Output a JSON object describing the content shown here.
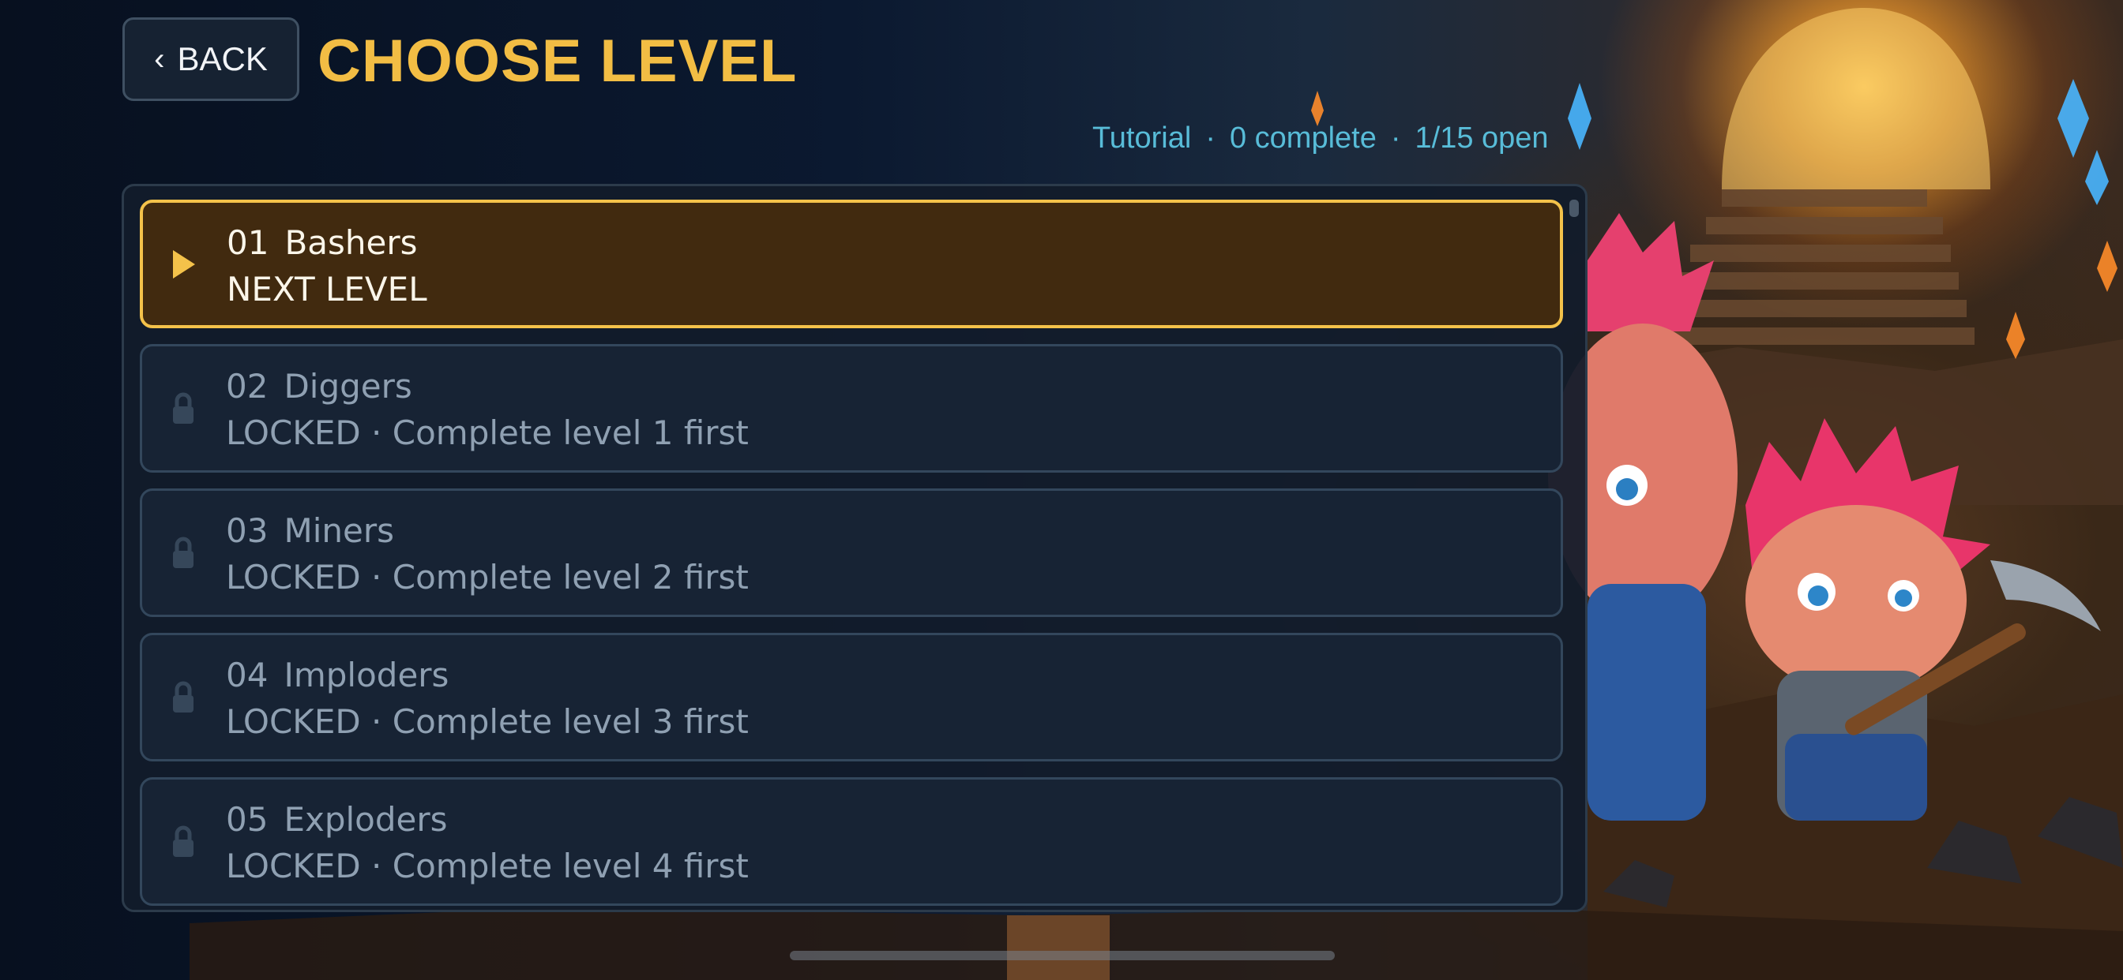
{
  "header": {
    "back_label": "BACK",
    "back_icon": "chevron-left-icon",
    "title": "CHOOSE LEVEL"
  },
  "status": {
    "mode": "Tutorial",
    "separator": "·",
    "complete": "0 complete",
    "open": "1/15 open"
  },
  "levels": [
    {
      "num": "01",
      "name": "Bashers",
      "status": "NEXT LEVEL",
      "state": "active",
      "icon": "play-icon"
    },
    {
      "num": "02",
      "name": "Diggers",
      "status": "LOCKED · Complete level 1 first",
      "state": "locked",
      "icon": "lock-icon"
    },
    {
      "num": "03",
      "name": "Miners",
      "status": "LOCKED · Complete level 2 first",
      "state": "locked",
      "icon": "lock-icon"
    },
    {
      "num": "04",
      "name": "Imploders",
      "status": "LOCKED · Complete level 3 first",
      "state": "locked",
      "icon": "lock-icon"
    },
    {
      "num": "05",
      "name": "Exploders",
      "status": "LOCKED · Complete level 4 first",
      "state": "locked",
      "icon": "lock-icon"
    }
  ],
  "colors": {
    "accent": "#f2bd44",
    "status_text": "#58bcd8",
    "active_card": "#412a0f",
    "locked_card": "#172334"
  }
}
